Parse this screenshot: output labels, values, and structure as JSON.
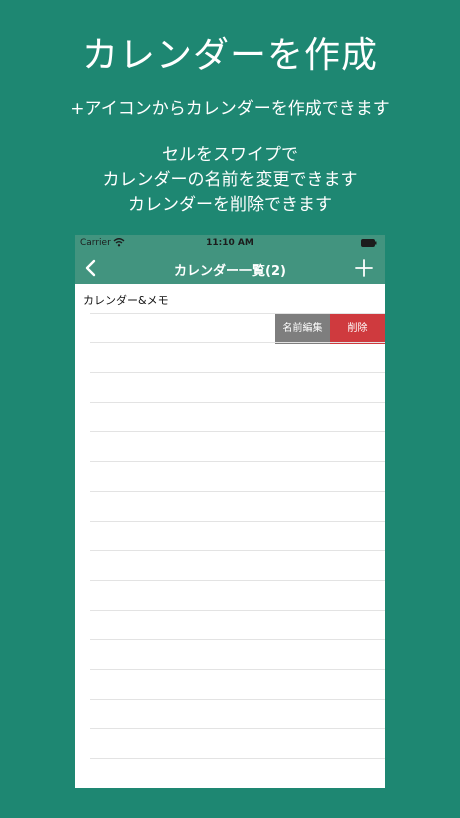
{
  "promo": {
    "headline": "カレンダーを作成",
    "subtitle": "+アイコンからカレンダーを作成できます",
    "desc_line1": "セルをスワイプで",
    "desc_line2": "カレンダーの名前を変更できます",
    "desc_line3": "カレンダーを削除できます"
  },
  "status_bar": {
    "carrier": "Carrier",
    "time": "11:10 AM"
  },
  "nav": {
    "title": "カレンダー一覧(2)",
    "back_icon": "chevron-left-icon",
    "add_icon": "plus-icon"
  },
  "list": {
    "items": [
      {
        "label": "カレンダー&メモ"
      },
      {
        "label": ""
      }
    ],
    "swipe_actions": {
      "edit_label": "名前編集",
      "delete_label": "削除"
    }
  },
  "colors": {
    "background": "#1e8772",
    "nav": "#42947f",
    "edit": "#7e7e7e",
    "delete": "#cf3a3e"
  }
}
